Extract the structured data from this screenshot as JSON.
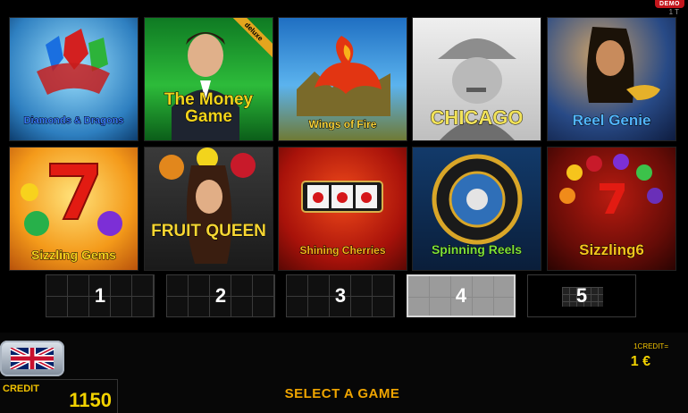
{
  "header": {
    "badge": "DEMO",
    "badge_sub": "1 T"
  },
  "games": [
    {
      "title": "Diamonds & Dragons",
      "bg": "#3ba9d9",
      "title_color": "#3a7bff"
    },
    {
      "title": "The Money Game",
      "badge": "deluxe",
      "bg": "#1e8b2e",
      "title_color": "#f2d41c"
    },
    {
      "title": "Wings of Fire",
      "bg": "#3a8ad8",
      "title_color": "#f6d23a"
    },
    {
      "title": "CHICAGO",
      "bg": "#d9d9d9",
      "title_color": "#f2e35a"
    },
    {
      "title": "Reel Genie",
      "bg": "#1f2a5e",
      "title_color": "#52b6ff"
    },
    {
      "title": "Sizzling Gems",
      "bg": "#f08b1a",
      "title_color": "#f7d21d"
    },
    {
      "title": "FRUIT QUEEN",
      "bg": "#2b2b2b",
      "title_color": "#f7d633"
    },
    {
      "title": "Shining Cherries",
      "bg": "#b51c0b",
      "title_color": "#f6b21a"
    },
    {
      "title": "Spinning Reels",
      "bg": "#0a2d55",
      "title_color": "#7ee03a"
    },
    {
      "title": "Sizzling6",
      "bg": "#6e0f0a",
      "title_color": "#f6c41c"
    }
  ],
  "pager": {
    "pages": [
      "1",
      "2",
      "3",
      "4",
      "5"
    ],
    "active": "4"
  },
  "footer": {
    "credit_label": "CREDIT",
    "credit_value": "1150",
    "select_label": "SELECT A GAME",
    "rate_label": "1CREDIT=",
    "rate_value": "1 €"
  }
}
